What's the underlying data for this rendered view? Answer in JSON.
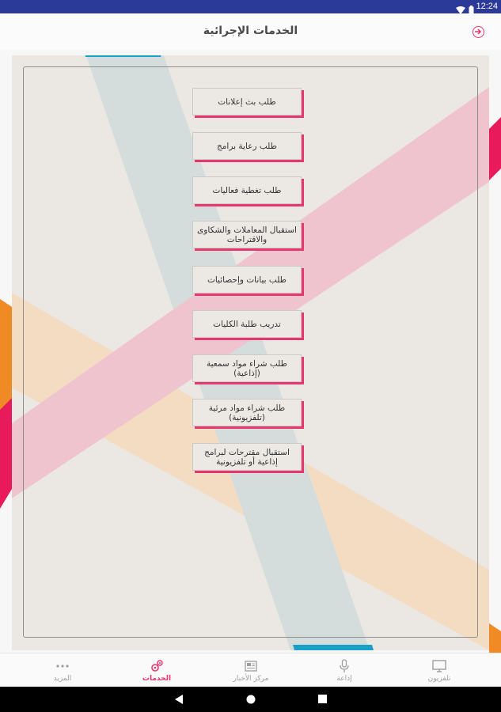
{
  "status_bar": {
    "time": "12:24"
  },
  "header": {
    "title": "الخدمات الإجرائية"
  },
  "services": [
    {
      "label": "طلب بث إعلانات"
    },
    {
      "label": "طلب رعاية برامج"
    },
    {
      "label": "طلب تغطية فعاليات"
    },
    {
      "label": "استقبال المعاملات والشكاوى والاقتراحات"
    },
    {
      "label": "طلب بيانات وإحصائيات"
    },
    {
      "label": "تدريب طلبة الكليات"
    },
    {
      "label": "طلب شراء مواد سمعية (إذاعية)"
    },
    {
      "label": "طلب شراء مواد مرئية (تلفزيونية)"
    },
    {
      "label": "استقبال مقترحات لبرامج إذاعية أو تلفزيونية"
    }
  ],
  "bottom_nav": {
    "items": [
      {
        "label": "تلفزيون",
        "icon": "tv-icon",
        "active": false
      },
      {
        "label": "إذاعة",
        "icon": "microphone-icon",
        "active": false
      },
      {
        "label": "مركز الأخبار",
        "icon": "news-icon",
        "active": false
      },
      {
        "label": "الخدمات",
        "icon": "services-icon",
        "active": true
      },
      {
        "label": "المزيد",
        "icon": "more-icon",
        "active": false
      }
    ]
  },
  "colors": {
    "status_bar": "#2b3a99",
    "accent": "#e8336b",
    "pink_stripe": "#f0c4cf",
    "blue_stripe": "#d4dcdc",
    "orange_stripe": "#f4dcc3",
    "orange_edge": "#f08a24",
    "blue_edge": "#1aa0c8"
  }
}
